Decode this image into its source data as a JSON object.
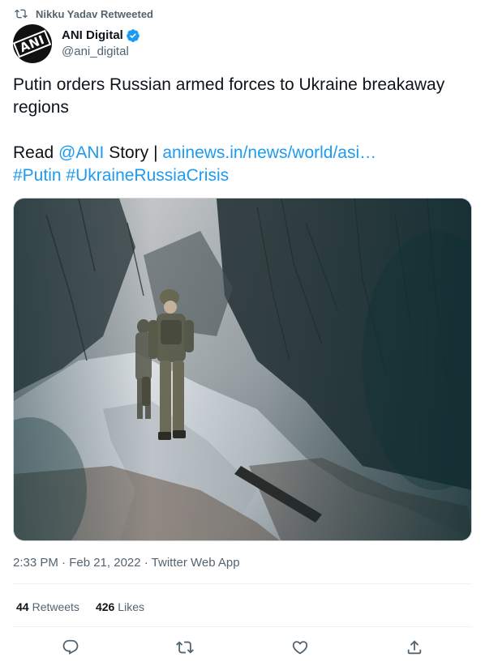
{
  "retweet": {
    "icon": "retweet-icon",
    "label": "Nikku Yadav Retweeted"
  },
  "author": {
    "name": "ANI Digital",
    "handle": "@ani_digital",
    "avatar_logo_text": "ANI",
    "verified_icon": "verified-badge-icon"
  },
  "tweet": {
    "line1": "Putin orders Russian armed forces to Ukraine breakaway regions",
    "read_prefix": "Read",
    "mention": "@ANI",
    "story_word": "Story |",
    "link": "aninews.in/news/world/asi…",
    "hashtag1": "#Putin",
    "hashtag2": "#UkraineRussiaCrisis"
  },
  "media": {
    "icon": "photo-soldier-in-snow"
  },
  "meta": {
    "text": "2:33 PM · Feb 21, 2022 · Twitter Web App"
  },
  "stats": {
    "retweets_count": "44",
    "retweets_label": "Retweets",
    "likes_count": "426",
    "likes_label": "Likes"
  },
  "actions": {
    "reply_icon": "reply-icon",
    "retweet_icon": "retweet-icon",
    "like_icon": "heart-icon",
    "share_icon": "share-icon"
  },
  "colors": {
    "link": "#1d9bf0",
    "secondary_text": "#536471",
    "primary_text": "#0f1419",
    "verified": "#1d9bf0"
  }
}
